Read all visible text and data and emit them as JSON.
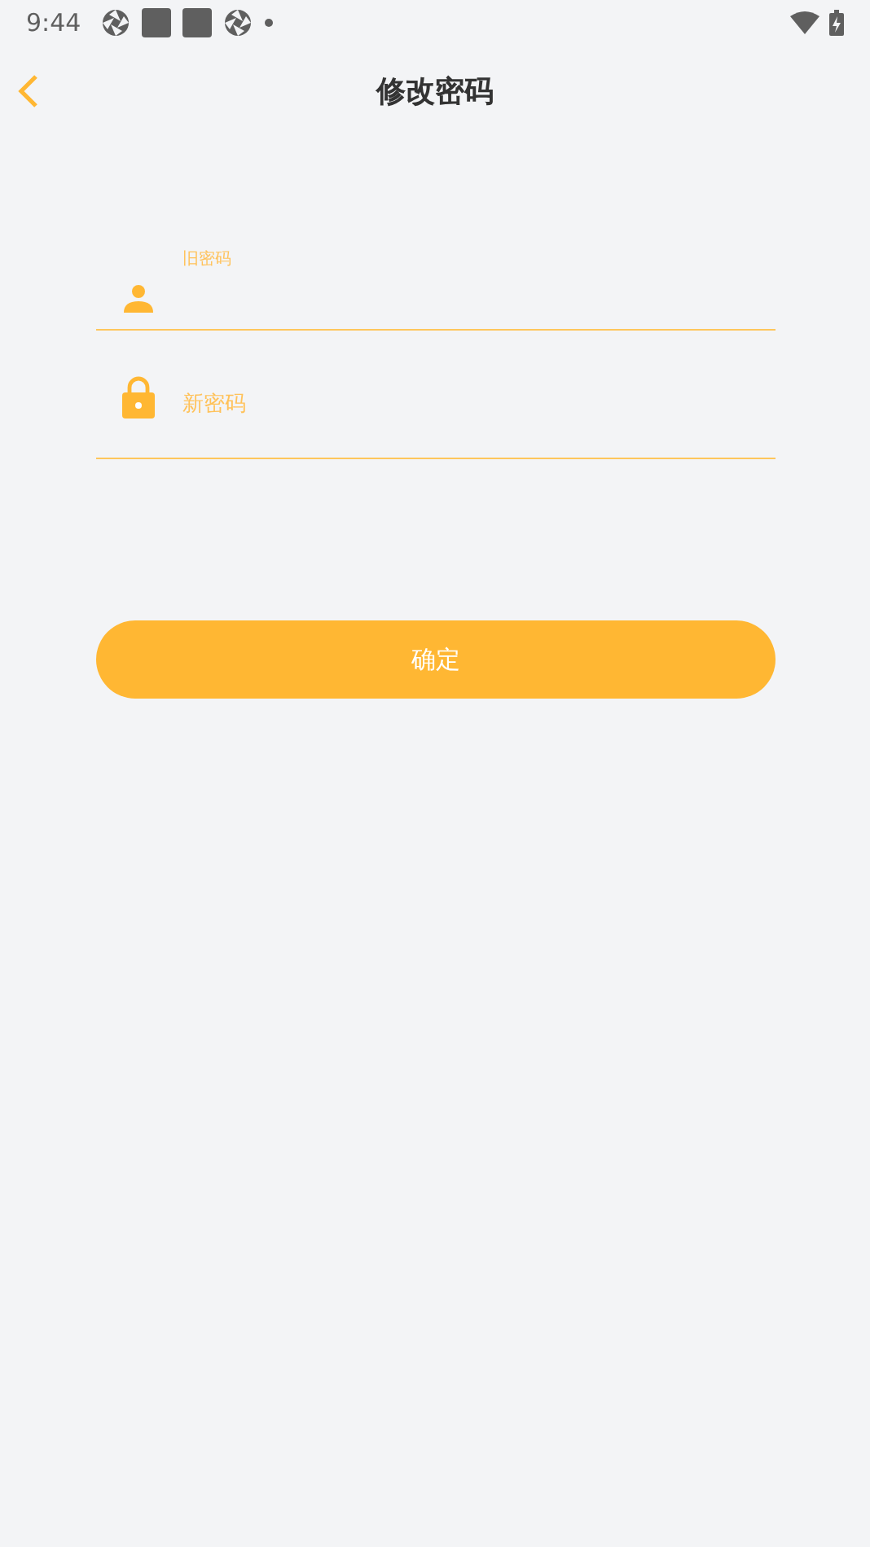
{
  "status_bar": {
    "time": "9:44"
  },
  "header": {
    "title": "修改密码"
  },
  "fields": [
    {
      "kind": "user",
      "label": "旧密码",
      "floated": true
    },
    {
      "kind": "lock",
      "label": "新密码",
      "floated": false
    }
  ],
  "submit_button": {
    "label": "确定"
  }
}
